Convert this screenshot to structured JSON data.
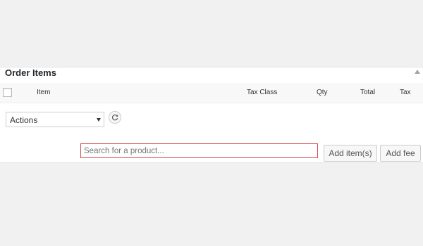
{
  "panel": {
    "title": "Order Items"
  },
  "table": {
    "columns": {
      "item": "Item",
      "tax_class": "Tax Class",
      "qty": "Qty",
      "total": "Total",
      "tax": "Tax"
    }
  },
  "actions": {
    "selected": "Actions"
  },
  "search": {
    "placeholder": "Search for a product..."
  },
  "buttons": {
    "add_items": "Add item(s)",
    "add_fee": "Add fee"
  },
  "icons": {
    "toggle": "triangle-up-icon",
    "refresh": "refresh-icon",
    "dropdown": "caret-down-icon"
  },
  "colors": {
    "search_border": "#d34a4a",
    "panel_bg": "#ffffff",
    "page_bg": "#f1f1f1"
  }
}
